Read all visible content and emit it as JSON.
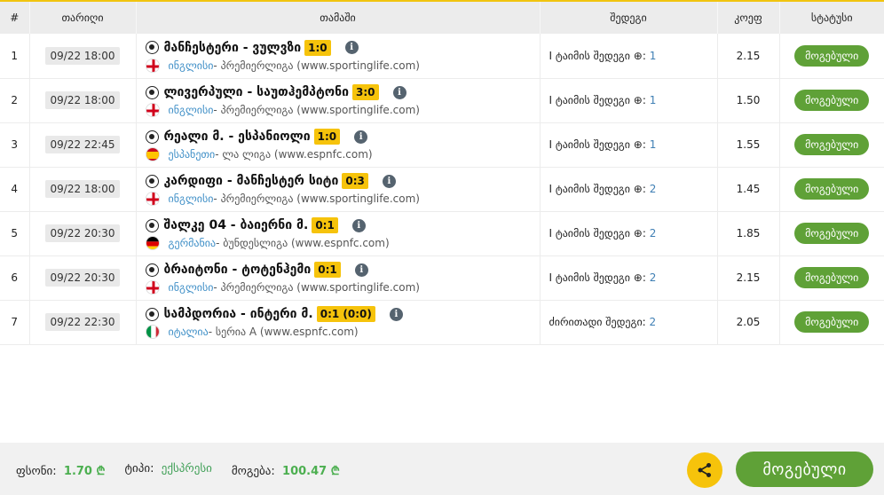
{
  "header": {
    "num": "#",
    "date": "თარიღი",
    "match": "თამაში",
    "result": "შედეგი",
    "odds": "კოეფ",
    "status": "სტატუსი"
  },
  "rows": [
    {
      "num": "1",
      "date": "09/22 18:00",
      "teams": "მანჩესტერი - ვულვზი",
      "score": "1:0",
      "flag": "england",
      "country": "ინგლისი",
      "league": " - პრემიერლიგა (www.sportinglife.com)",
      "result_label": "I ტაიმის შედეგი ⊕: ",
      "result_value": "1",
      "odds": "2.15",
      "status": "მოგებული"
    },
    {
      "num": "2",
      "date": "09/22 18:00",
      "teams": "ლივერპული - საუთჰემპტონი",
      "score": "3:0",
      "flag": "england",
      "country": "ინგლისი",
      "league": " - პრემიერლიგა (www.sportinglife.com)",
      "result_label": "I ტაიმის შედეგი ⊕: ",
      "result_value": "1",
      "odds": "1.50",
      "status": "მოგებული"
    },
    {
      "num": "3",
      "date": "09/22 22:45",
      "teams": "რეალი მ. - ესპანიოლი",
      "score": "1:0",
      "flag": "spain",
      "country": "ესპანეთი",
      "league": " - ლა ლიგა (www.espnfc.com)",
      "result_label": "I ტაიმის შედეგი ⊕: ",
      "result_value": "1",
      "odds": "1.55",
      "status": "მოგებული"
    },
    {
      "num": "4",
      "date": "09/22 18:00",
      "teams": "კარდიფი - მანჩესტერ სიტი",
      "score": "0:3",
      "flag": "england",
      "country": "ინგლისი",
      "league": " - პრემიერლიგა (www.sportinglife.com)",
      "result_label": "I ტაიმის შედეგი ⊕: ",
      "result_value": "2",
      "odds": "1.45",
      "status": "მოგებული"
    },
    {
      "num": "5",
      "date": "09/22 20:30",
      "teams": "შალკე 04 - ბაიერნი მ.",
      "score": "0:1",
      "flag": "germany",
      "country": "გერმანია",
      "league": " - ბუნდესლიგა (www.espnfc.com)",
      "result_label": "I ტაიმის შედეგი ⊕: ",
      "result_value": "2",
      "odds": "1.85",
      "status": "მოგებული"
    },
    {
      "num": "6",
      "date": "09/22 20:30",
      "teams": "ბრაიტონი - ტოტენჰემი",
      "score": "0:1",
      "flag": "england",
      "country": "ინგლისი",
      "league": " - პრემიერლიგა (www.sportinglife.com)",
      "result_label": "I ტაიმის შედეგი ⊕: ",
      "result_value": "2",
      "odds": "2.15",
      "status": "მოგებული"
    },
    {
      "num": "7",
      "date": "09/22 22:30",
      "teams": "სამპდორია - ინტერი მ.",
      "score": "0:1 (0:0)",
      "flag": "italy",
      "country": "იტალია",
      "league": " - სერია A (www.espnfc.com)",
      "result_label": "ძირითადი შედეგი: ",
      "result_value": "2",
      "odds": "2.05",
      "status": "მოგებული"
    }
  ],
  "footer": {
    "odds_label": "ფსონი:",
    "odds_value": "1.70 ₾",
    "type_label": "ტიპი:",
    "type_value": "ექსპრესი",
    "win_label": "მოგება:",
    "win_value": "100.47 ₾",
    "status_button": "მოგებული",
    "share_icon": "share-icon"
  },
  "colors": {
    "accent_yellow": "#f6c30b",
    "won_green": "#5fa137",
    "link_blue": "#3f8fc7"
  }
}
